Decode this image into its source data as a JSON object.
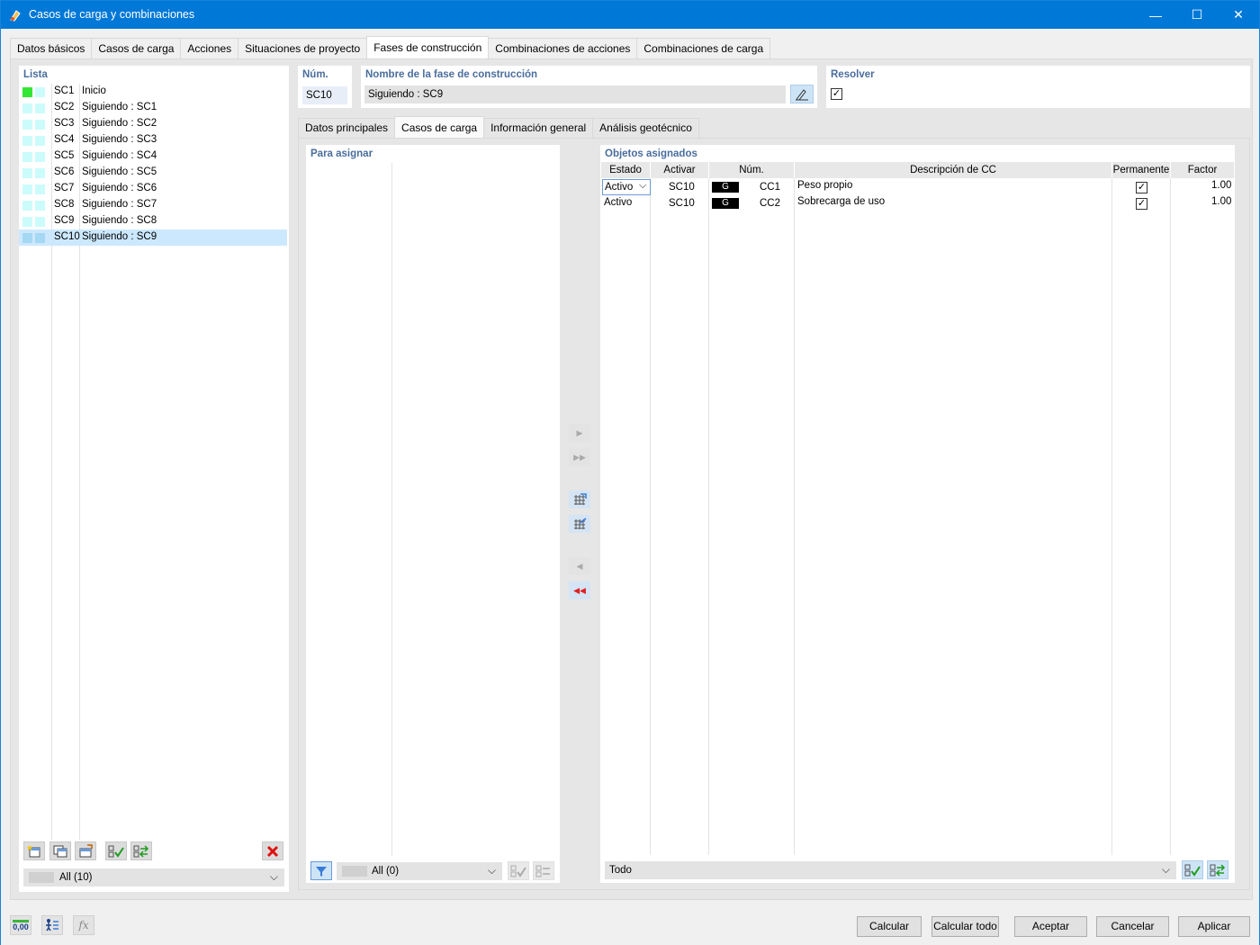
{
  "window": {
    "title": "Casos de carga y combinaciones",
    "minimize": "—",
    "maximize": "☐",
    "close": "✕"
  },
  "tabs": [
    "Datos básicos",
    "Casos de carga",
    "Acciones",
    "Situaciones de proyecto",
    "Fases de construcción",
    "Combinaciones de acciones",
    "Combinaciones de carga"
  ],
  "active_tab": 4,
  "list": {
    "title": "Lista",
    "items": [
      {
        "id": "SC1",
        "desc": "Inicio",
        "color": "#33e633"
      },
      {
        "id": "SC2",
        "desc": "Siguiendo : SC1",
        "color": "#ccfbfb"
      },
      {
        "id": "SC3",
        "desc": "Siguiendo : SC2",
        "color": "#ccfbfb"
      },
      {
        "id": "SC4",
        "desc": "Siguiendo : SC3",
        "color": "#ccfbfb"
      },
      {
        "id": "SC5",
        "desc": "Siguiendo : SC4",
        "color": "#ccfbfb"
      },
      {
        "id": "SC6",
        "desc": "Siguiendo : SC5",
        "color": "#ccfbfb"
      },
      {
        "id": "SC7",
        "desc": "Siguiendo : SC6",
        "color": "#ccfbfb"
      },
      {
        "id": "SC8",
        "desc": "Siguiendo : SC7",
        "color": "#ccfbfb"
      },
      {
        "id": "SC9",
        "desc": "Siguiendo : SC8",
        "color": "#ccfbfb"
      },
      {
        "id": "SC10",
        "desc": "Siguiendo : SC9",
        "color": "#a5d8f3"
      }
    ],
    "selected_index": 9,
    "filter": "All (10)"
  },
  "num": {
    "label": "Núm.",
    "value": "SC10"
  },
  "name": {
    "label": "Nombre de la fase de construcción",
    "value": "Siguiendo : SC9"
  },
  "resolver": {
    "label": "Resolver",
    "checked": true,
    "mark": "✓"
  },
  "subtabs": [
    "Datos principales",
    "Casos de carga",
    "Información general",
    "Análisis geotécnico"
  ],
  "active_subtab": 1,
  "to_assign": {
    "title": "Para asignar",
    "filter": "All (0)"
  },
  "assigned": {
    "title": "Objetos asignados",
    "columns": [
      "Estado",
      "Activar",
      "Núm.",
      "Descripción de CC",
      "Permanente",
      "Factor"
    ],
    "rows": [
      {
        "estado": "Activo",
        "activar": "SC10",
        "badge": "G",
        "num": "CC1",
        "desc": "Peso propio",
        "permanente": "✓",
        "factor": "1.00"
      },
      {
        "estado": "Activo",
        "activar": "SC10",
        "badge": "G",
        "num": "CC2",
        "desc": "Sobrecarga de uso",
        "permanente": "✓",
        "factor": "1.00"
      }
    ],
    "filter": "Todo"
  },
  "buttons": {
    "calcular": "Calcular",
    "calcular_todo": "Calcular todo",
    "aceptar": "Aceptar",
    "cancelar": "Cancelar",
    "aplicar": "Aplicar"
  },
  "bottom_icons": {
    "units": "0,00",
    "fx": "fx"
  },
  "colors": {
    "titlebar": "#0078d7",
    "accent_label": "#4a6d9c",
    "selected_row": "#cce8ff"
  }
}
